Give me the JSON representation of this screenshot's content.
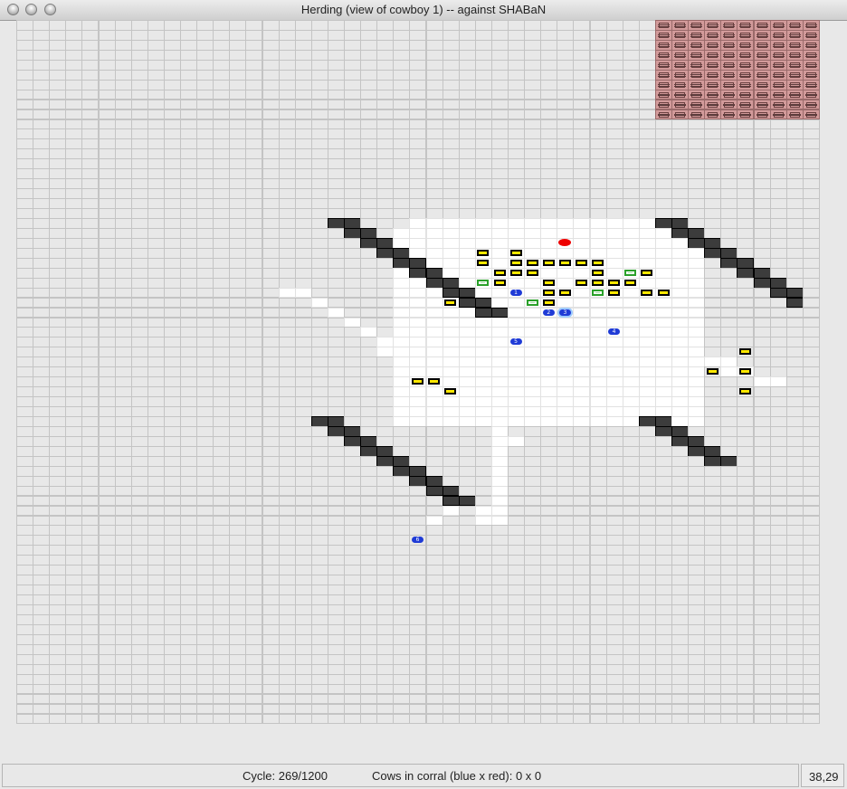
{
  "window": {
    "title": "Herding (view of cowboy 1) -- against SHABaN"
  },
  "status": {
    "cycle": "Cycle: 269/1200",
    "cows_in_corral": "Cows in corral (blue x red): 0 x 0",
    "cursor_coords": "38,29"
  },
  "colors": {
    "fence": "#3c3c3c",
    "cow": "#ffe800",
    "own_cowboy": "#1f3bd6",
    "opponent_cowboy": "#ee0000",
    "corral": "#d29a9a",
    "visible_cell": "#ffffff",
    "unseen_cell": "#e8e8e8",
    "cow_memory": "#2aa02a"
  },
  "grid": {
    "cols": 49,
    "rows": 71
  },
  "cowboys": [
    {
      "id": "1"
    },
    {
      "id": "2"
    },
    {
      "id": "3"
    },
    {
      "id": "4"
    },
    {
      "id": "5"
    },
    {
      "id": "6"
    }
  ],
  "icons": {
    "traffic_lights": [
      "close-icon",
      "minimize-icon",
      "zoom-icon"
    ],
    "corral_tile": "corral-crate-icon"
  }
}
